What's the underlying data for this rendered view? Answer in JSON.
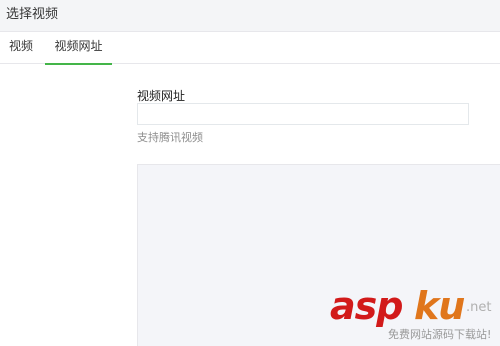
{
  "dialog": {
    "title": "选择视频"
  },
  "tabs": [
    {
      "label": "视频",
      "active": false
    },
    {
      "label": "视频网址",
      "active": true
    }
  ],
  "form": {
    "url_label": "视频网址",
    "url_value": "",
    "url_placeholder": "",
    "hint": "支持腾讯视频"
  },
  "colors": {
    "active_tab_underline": "#44b549",
    "header_bg": "#f4f5f7",
    "preview_bg": "#f4f5f9"
  },
  "watermark": {
    "brand_part1": "asp",
    "brand_part2": "ku",
    "domain_suffix": ".net",
    "tagline": "免费网站源码下载站!"
  }
}
